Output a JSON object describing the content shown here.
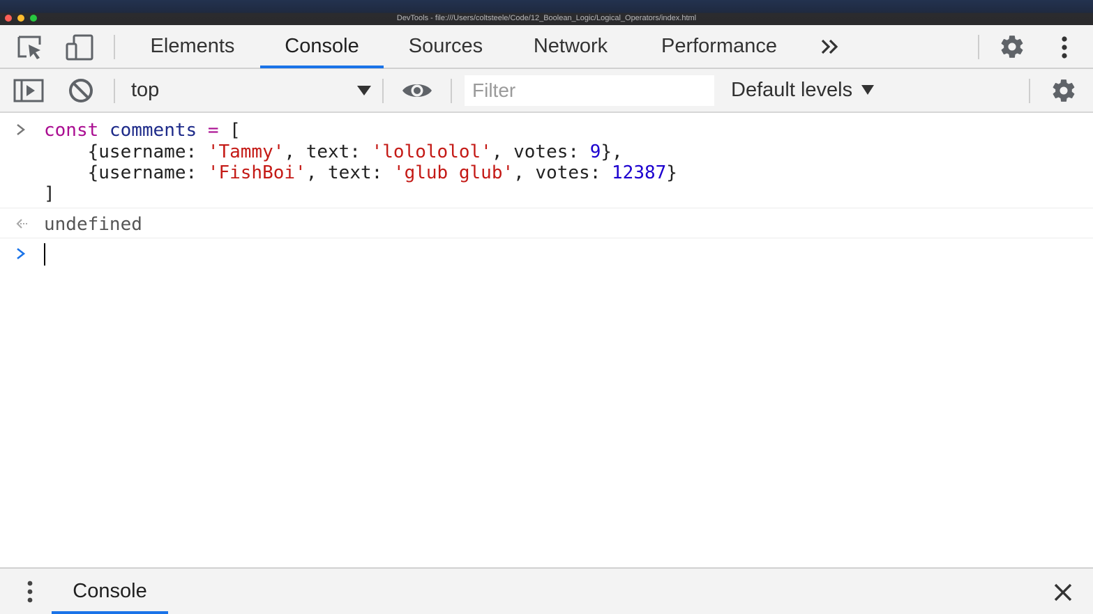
{
  "window": {
    "title": "DevTools - file:///Users/coltsteele/Code/12_Boolean_Logic/Logical_Operators/index.html"
  },
  "tabbar": {
    "tabs": [
      {
        "label": "Elements",
        "active": false
      },
      {
        "label": "Console",
        "active": true
      },
      {
        "label": "Sources",
        "active": false
      },
      {
        "label": "Network",
        "active": false
      },
      {
        "label": "Performance",
        "active": false
      }
    ],
    "more_icon": "double-chevron-right-icon",
    "settings_icon": "gear-icon",
    "menu_icon": "vertical-dots-icon"
  },
  "toolbar": {
    "context": "top",
    "filter_placeholder": "Filter",
    "levels": "Default levels"
  },
  "console": {
    "input": {
      "keyword": "const",
      "name": "comments",
      "op": "=",
      "open_bracket": "[",
      "row1": {
        "username": "'Tammy'",
        "text": "'lolololol'",
        "votes": "9",
        "trail": "},"
      },
      "row2": {
        "username": "'FishBoi'",
        "text": "'glub glub'",
        "votes": "12387",
        "trail": "}"
      },
      "close_bracket": "]"
    },
    "result": "undefined"
  },
  "drawer": {
    "tab_label": "Console"
  },
  "colors": {
    "accent": "#1a73e8",
    "keyword": "#aa0d91",
    "string": "#c41a16",
    "number": "#1c00cf"
  }
}
